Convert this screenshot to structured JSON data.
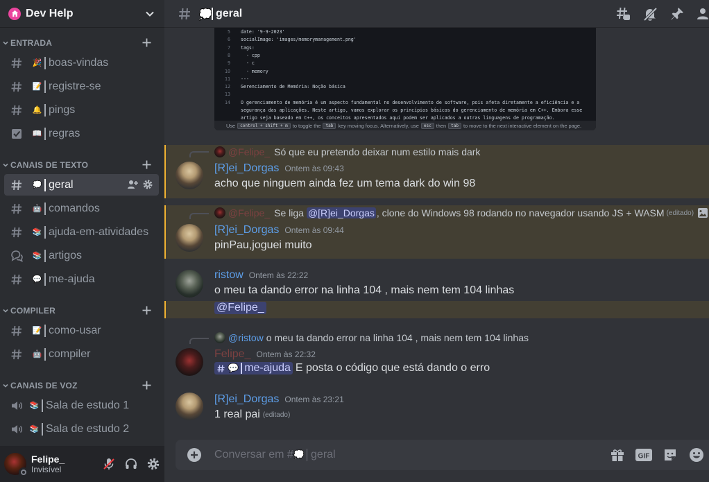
{
  "server": {
    "name": "Dev Help"
  },
  "categories": [
    {
      "label": "ENTRADA"
    },
    {
      "label": "CANAIS DE TEXTO"
    },
    {
      "label": "COMPILER"
    },
    {
      "label": "CANAIS DE VOZ"
    }
  ],
  "channels": {
    "boas_vindas": {
      "name": "boas-vindas",
      "emoji": "🎉"
    },
    "registre_se": {
      "name": "registre-se",
      "emoji": "📝"
    },
    "pings": {
      "name": "pings",
      "emoji": "🔔"
    },
    "regras": {
      "name": "regras",
      "emoji": "📖"
    },
    "geral": {
      "name": "geral",
      "emoji": "💭"
    },
    "comandos": {
      "name": "comandos",
      "emoji": "🤖"
    },
    "ajuda_em_atividades": {
      "name": "ajuda-em-atividades",
      "emoji": "📚"
    },
    "artigos": {
      "name": "artigos",
      "emoji": "📚"
    },
    "me_ajuda": {
      "name": "me-ajuda",
      "emoji": "💬"
    },
    "como_usar": {
      "name": "como-usar",
      "emoji": "📝"
    },
    "compiler": {
      "name": "compiler",
      "emoji": "🤖"
    },
    "sala_1": {
      "name": "Sala de estudo 1",
      "emoji": "📚"
    },
    "sala_2": {
      "name": "Sala de estudo 2",
      "emoji": "📚"
    }
  },
  "user": {
    "name": "Felipe_",
    "status": "Invisível"
  },
  "header": {
    "channel": "geral",
    "emoji": "💭"
  },
  "code_image": {
    "lines": [
      {
        "n": "5",
        "t": "date: '9-9-2023'"
      },
      {
        "n": "6",
        "t": "socialImage: 'images/memorymanagement.png'"
      },
      {
        "n": "7",
        "t": "tags:"
      },
      {
        "n": "8",
        "t": "  - cpp"
      },
      {
        "n": "9",
        "t": "  - c"
      },
      {
        "n": "10",
        "t": "  - memory"
      },
      {
        "n": "11",
        "t": "---"
      },
      {
        "n": "12",
        "t": "Gerenciamento de Memória: Noção básica"
      },
      {
        "n": "13",
        "t": ""
      },
      {
        "n": "14",
        "t": "O gerenciamento de memória é um aspecto fundamental no desenvolvimento de software, pois afeta diretamente a eficiência e a"
      },
      {
        "n": "",
        "t": "segurança das aplicações. Neste artigo, vamos explorar os princípios básicos do gerenciamento de memória em C++. Embora esse"
      },
      {
        "n": "",
        "t": "artigo seja baseado em C++, os conceitos apresentados aqui podem ser aplicados a outras linguagens de programação."
      }
    ],
    "footer": {
      "use": "Use",
      "k1": "control + shift + m",
      "mid": "to toggle the",
      "k2": "tab",
      "mid2": "key moving focus. Alternatively, use",
      "k3": "esc",
      "then": "then",
      "k4": "tab",
      "end": "to move to the next interactive element on the page."
    }
  },
  "messages": {
    "m1": {
      "reply_name": "@Felipe_",
      "reply_text": "Só que eu pretendo deixar num estilo mais dark",
      "author": "[R]ei_Dorgas",
      "time": "Ontem às 09:43",
      "text": "acho que ninguem ainda fez um tema dark do win 98",
      "author_color": "#5d9ee8"
    },
    "m2": {
      "reply_name": "@Felipe_",
      "reply_pre": "Se liga",
      "reply_mention": "@[R]ei_Dorgas",
      "reply_post": ", clone do Windows 98 rodando no navegador usando JS + WASM",
      "reply_edited": "(editado)",
      "author": "[R]ei_Dorgas",
      "time": "Ontem às 09:44",
      "text": "pinPau,joguei muito"
    },
    "m3": {
      "author": "ristow",
      "time": "Ontem às 22:22",
      "text": "o meu ta dando error na linha 104 , mais nem tem 104 linhas",
      "mention": "@Felipe_",
      "author_color": "#5d9ee8"
    },
    "m4": {
      "reply_name": "@ristow",
      "reply_text": "o meu ta dando error na linha 104 , mais nem tem 104 linhas",
      "author": "Felipe_",
      "time": "Ontem às 22:32",
      "channel_mention": "me-ajuda",
      "text": "E posta o código que está dando o erro",
      "author_color": "#7b4141"
    },
    "m5": {
      "author": "[R]ei_Dorgas",
      "time": "Ontem às 23:21",
      "text": "1 real pai",
      "edited": "(editado)"
    }
  },
  "composer": {
    "placeholder_prefix": "Conversar em #",
    "emoji": "💭",
    "channel": "geral"
  },
  "colors": {
    "accent": "#5865f2",
    "mention_bg": "#433f33",
    "mention_bar": "#f0b232",
    "blue_name": "#5d9ee8"
  }
}
